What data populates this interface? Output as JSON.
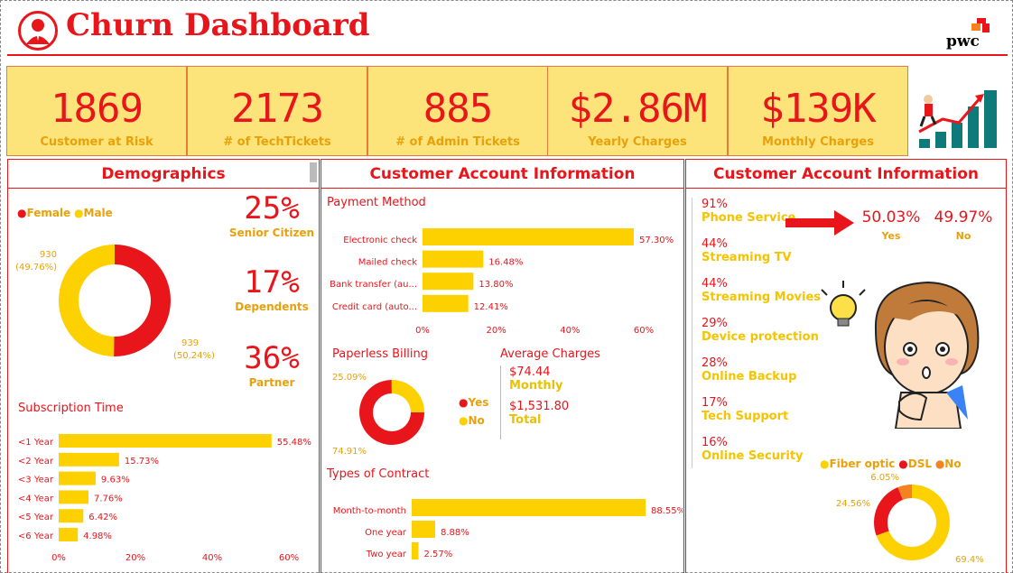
{
  "title": "Churn Dashboard",
  "brand": "pwc",
  "kpis": [
    {
      "value": "1869",
      "label": "Customer at Risk"
    },
    {
      "value": "2173",
      "label": "# of TechTickets"
    },
    {
      "value": "885",
      "label": "# of Admin Tickets"
    },
    {
      "value": "$2.86M",
      "label": "Yearly Charges"
    },
    {
      "value": "$139K",
      "label": "Monthly Charges"
    }
  ],
  "demographics": {
    "title": "Demographics",
    "legend": [
      "Female",
      "Male"
    ],
    "stats": [
      {
        "value": "25%",
        "label": "Senior Citizen"
      },
      {
        "value": "17%",
        "label": "Dependents"
      },
      {
        "value": "36%",
        "label": "Partner"
      }
    ],
    "subscription_title": "Subscription Time"
  },
  "account1": {
    "title": "Customer Account Information",
    "payment_title": "Payment Method",
    "paperless_title": "Paperless Billing",
    "paperless_legend": [
      "Yes",
      "No"
    ],
    "avg_title": "Average Charges",
    "avg_monthly_value": "$74.44",
    "avg_monthly_label": "Monthly",
    "avg_total_value": "$1,531.80",
    "avg_total_label": "Total",
    "contract_title": "Types of Contract"
  },
  "account2": {
    "title": "Customer Account Information",
    "services": [
      {
        "pct": "91%",
        "name": "Phone Service"
      },
      {
        "pct": "44%",
        "name": "Streaming TV"
      },
      {
        "pct": "44%",
        "name": "Streaming Movies"
      },
      {
        "pct": "29%",
        "name": "Device protection"
      },
      {
        "pct": "28%",
        "name": "Online Backup"
      },
      {
        "pct": "17%",
        "name": "Tech Support"
      },
      {
        "pct": "16%",
        "name": "Online Security"
      }
    ],
    "phone_yes_pct": "50.03%",
    "phone_yes_label": "Yes",
    "phone_no_pct": "49.97%",
    "phone_no_label": "No",
    "internet_legend": [
      "Fiber optic",
      "DSL",
      "No"
    ]
  },
  "colors": {
    "red": "#e8151b",
    "gold": "#fdd000",
    "orange": "#f58220",
    "kpi_bg": "#fde47a"
  },
  "chart_data": [
    {
      "type": "pie",
      "title": "",
      "categories": [
        "Female",
        "Male"
      ],
      "values": [
        939,
        930
      ],
      "data_labels": [
        "939\n(50.24%)",
        "930\n(49.76%)"
      ]
    },
    {
      "type": "bar",
      "title": "Subscription Time",
      "categories": [
        "<1 Year",
        "<2 Year",
        "<3 Year",
        "<4 Year",
        "<5 Year",
        "<6 Year"
      ],
      "values": [
        55.48,
        15.73,
        9.63,
        7.76,
        6.42,
        4.98
      ],
      "data_labels": [
        "55.48%",
        "15.73%",
        "9.63%",
        "7.76%",
        "6.42%",
        "4.98%"
      ],
      "xticks": [
        "0%",
        "20%",
        "40%",
        "60%"
      ],
      "xlim": [
        0,
        60
      ]
    },
    {
      "type": "bar",
      "title": "Payment Method",
      "categories": [
        "Electronic check",
        "Mailed check",
        "Bank transfer (au...",
        "Credit card (auto..."
      ],
      "values": [
        57.3,
        16.48,
        13.8,
        12.41
      ],
      "data_labels": [
        "57.30%",
        "16.48%",
        "13.80%",
        "12.41%"
      ],
      "xticks": [
        "0%",
        "20%",
        "40%",
        "60%"
      ],
      "xlim": [
        0,
        60
      ]
    },
    {
      "type": "pie",
      "title": "Paperless Billing",
      "categories": [
        "Yes",
        "No"
      ],
      "values": [
        74.91,
        25.09
      ],
      "data_labels": [
        "74.91%",
        "25.09%"
      ]
    },
    {
      "type": "bar",
      "title": "Types of Contract",
      "categories": [
        "Month-to-month",
        "One year",
        "Two year"
      ],
      "values": [
        88.55,
        8.88,
        2.57
      ],
      "data_labels": [
        "88.55%",
        "8.88%",
        "2.57%"
      ],
      "xlim": [
        0,
        88.55
      ]
    },
    {
      "type": "pie",
      "title": "",
      "categories": [
        "Fiber optic",
        "DSL",
        "No"
      ],
      "values": [
        69.4,
        24.56,
        6.05
      ],
      "data_labels": [
        "69.4%",
        "24.56%",
        "6.05%"
      ]
    }
  ]
}
